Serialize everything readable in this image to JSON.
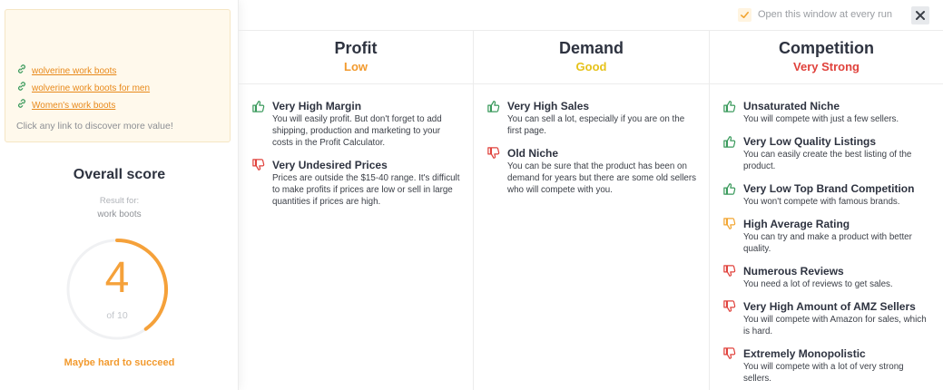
{
  "links": {
    "items": [
      {
        "label": "wolverine work boots"
      },
      {
        "label": "wolverine work boots for men"
      },
      {
        "label": "Women's work boots"
      }
    ],
    "hint": "Click any link to discover more value!"
  },
  "score": {
    "title": "Overall score",
    "result_for_label": "Result for:",
    "keyword": "work boots",
    "value": "4",
    "of_label": "of 10",
    "score_fraction": 0.4,
    "verdict": "Maybe hard to succeed"
  },
  "topbar": {
    "open_label": "Open this window at every run",
    "checkbox_checked": true
  },
  "colors": {
    "accent": "#f5a13a",
    "positive": "#3a9a5c",
    "warning": "#f2a532",
    "negative": "#e0423c",
    "good": "#e6c21a"
  },
  "columns": [
    {
      "title": "Profit",
      "rating": "Low",
      "rating_color": "#f29a2e",
      "items": [
        {
          "icon": "thumbs-up-icon",
          "tone": "positive",
          "title": "Very High Margin",
          "desc": "You will easily profit. But don't forget to add shipping, production and marketing to your costs in the Profit Calculator."
        },
        {
          "icon": "thumbs-down-icon",
          "tone": "negative",
          "title": "Very Undesired Prices",
          "desc": "Prices are outside the $15-40 range. It's difficult to make profits if prices are low or sell in large quantities if prices are high."
        }
      ]
    },
    {
      "title": "Demand",
      "rating": "Good",
      "rating_color": "#e6c21a",
      "items": [
        {
          "icon": "thumbs-up-icon",
          "tone": "positive",
          "title": "Very High Sales",
          "desc": "You can sell a lot, especially if you are on the first page."
        },
        {
          "icon": "thumbs-down-icon",
          "tone": "negative",
          "title": "Old Niche",
          "desc": "You can be sure that the product has been on demand for years but there are some old sellers who will compete with you."
        }
      ]
    },
    {
      "title": "Competition",
      "rating": "Very Strong",
      "rating_color": "#e0423c",
      "items": [
        {
          "icon": "thumbs-up-icon",
          "tone": "positive",
          "title": "Unsaturated Niche",
          "desc": "You will compete with just a few sellers."
        },
        {
          "icon": "thumbs-up-icon",
          "tone": "positive",
          "title": "Very Low Quality Listings",
          "desc": "You can easily create the best listing of the product."
        },
        {
          "icon": "thumbs-up-icon",
          "tone": "positive",
          "title": "Very Low Top Brand Competition",
          "desc": "You won't compete with famous brands."
        },
        {
          "icon": "thumbs-down-icon",
          "tone": "warning",
          "title": "High Average Rating",
          "desc": "You can try and make a product with better quality."
        },
        {
          "icon": "thumbs-down-icon",
          "tone": "negative",
          "title": "Numerous Reviews",
          "desc": "You need a lot of reviews to get sales."
        },
        {
          "icon": "thumbs-down-icon",
          "tone": "negative",
          "title": "Very High Amount of AMZ Sellers",
          "desc": "You will compete with Amazon for sales, which is hard."
        },
        {
          "icon": "thumbs-down-icon",
          "tone": "negative",
          "title": "Extremely Monopolistic",
          "desc": "You will compete with a lot of very strong sellers."
        }
      ]
    }
  ]
}
